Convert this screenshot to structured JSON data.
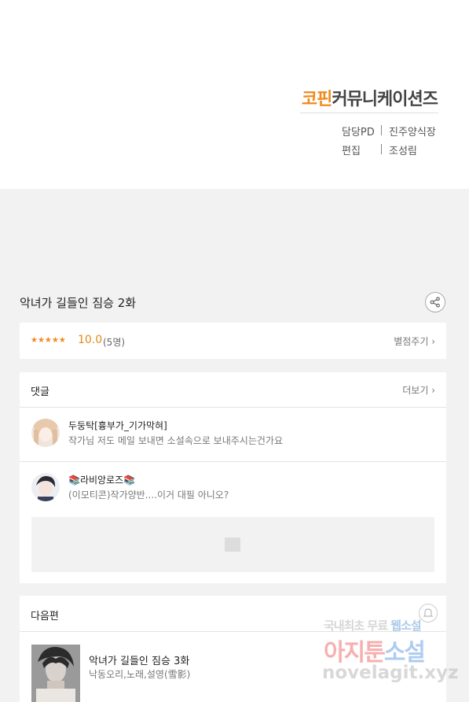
{
  "publisher": {
    "accent": "코핀",
    "rest": "커뮤니케이션즈"
  },
  "credits": [
    {
      "label": "담당PD",
      "value": "진주양식장"
    },
    {
      "label": "편집",
      "value": "조성림"
    }
  ],
  "episode": {
    "title": "악녀가 길들인 짐승 2화"
  },
  "rating": {
    "stars": "★★★★★",
    "score": "10.0",
    "count": "(5명)",
    "rate_label": "별점주기 ›"
  },
  "comments": {
    "title": "댓글",
    "more_label": "더보기 ›",
    "items": [
      {
        "name": "두둥탁[흉부가_기가막혀]",
        "text": "작가님 저도 메일 보내면 소설속으로 보내주시는건가요"
      },
      {
        "name": "📚라비앙로즈📚",
        "text": "(이모티콘)작가양반....이거 대필 아니오?"
      }
    ]
  },
  "next": {
    "title": "다음편",
    "episode_title": "악녀가 길들인 짐승 3화",
    "authors": "낙동오리,노래,설영(雪影)"
  },
  "watermark": {
    "line1_a": "국내최초 무료 ",
    "line1_b": "웹소설",
    "line2_a": "아지툰",
    "line2_b": "소설",
    "line3": "novelagit.xyz"
  },
  "colors": {
    "accent": "#f08a1c",
    "background": "#f2f2f2"
  }
}
